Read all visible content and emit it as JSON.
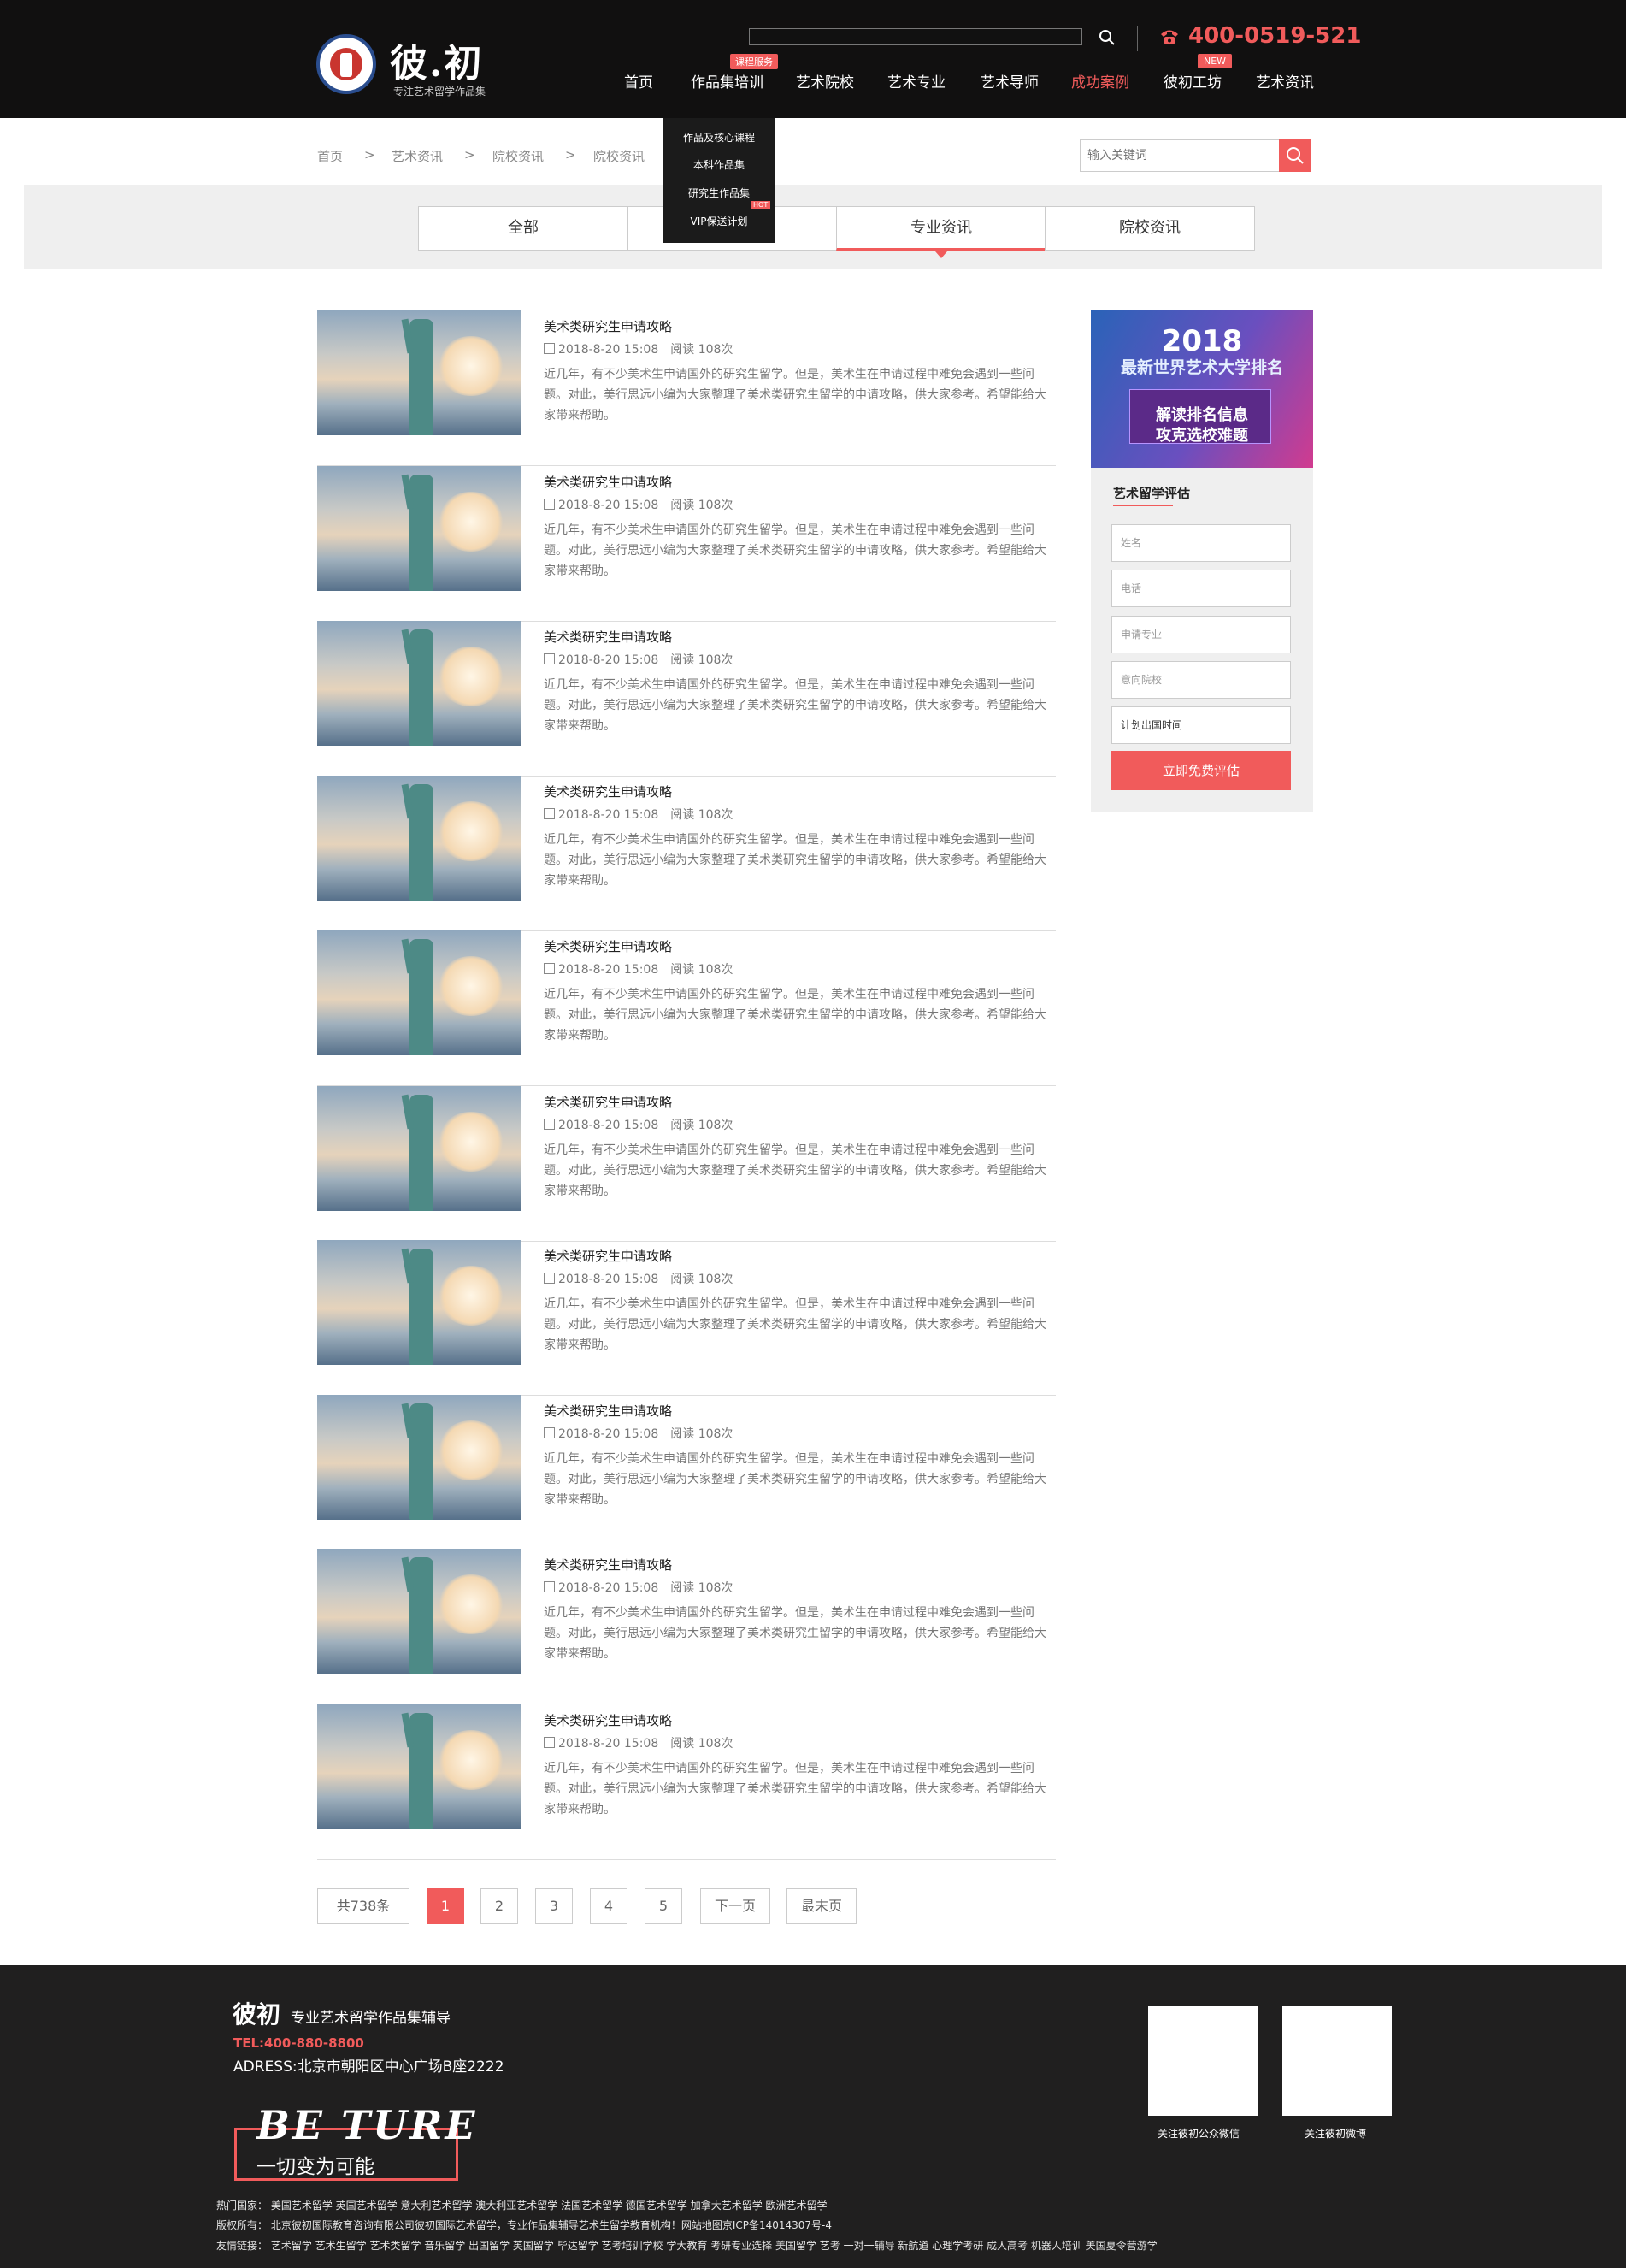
{
  "header": {
    "brand": "彼.初",
    "brand_sub": "专注艺术留学作品集",
    "search_placeholder": "",
    "phone": "400-0519-521",
    "nav": [
      {
        "label": "首页",
        "badge": ""
      },
      {
        "label": "作品集培训",
        "badge": "课程服务"
      },
      {
        "label": "艺术院校",
        "badge": ""
      },
      {
        "label": "艺术专业",
        "badge": ""
      },
      {
        "label": "艺术导师",
        "badge": ""
      },
      {
        "label": "成功案例",
        "badge": ""
      },
      {
        "label": "彼初工坊",
        "badge": "NEW"
      },
      {
        "label": "艺术资讯",
        "badge": ""
      }
    ],
    "dropdown": [
      "作品及核心课程",
      "本科作品集",
      "研究生作品集",
      "VIP保送计划"
    ],
    "dropdown_hot": "HOT"
  },
  "breadcrumb": [
    "首页",
    ">",
    "艺术资讯",
    ">",
    "院校资讯",
    ">",
    "院校资讯"
  ],
  "search": {
    "placeholder": "输入关键词"
  },
  "tabs": [
    "全部",
    "",
    "专业资讯",
    "院校资讯"
  ],
  "article": {
    "title": "美术类研究生申请攻略",
    "date": "2018-8-20  15:08",
    "reads": "阅读  108次",
    "excerpt": "近几年，有不少美术生申请国外的研究生留学。但是，美术生在申请过程中难免会遇到一些问题。对此，美行思远小编为大家整理了美术类研究生留学的申请攻略，供大家参考。希望能给大家带来帮助。"
  },
  "sidebar": {
    "banner_year": "2018",
    "banner_line1": "最新世界艺术大学排名",
    "banner_line2": "解读排名信息",
    "banner_line3": "攻克选校难题",
    "form_title": "艺术留学评估",
    "fields": [
      "姓名",
      "电话",
      "申请专业",
      "意向院校",
      "计划出国时间"
    ],
    "submit": "立即免费评估"
  },
  "pagination": {
    "total": "共738条",
    "pages": [
      "1",
      "2",
      "3",
      "4",
      "5"
    ],
    "next": "下一页",
    "last": "最末页"
  },
  "footer": {
    "brand": "彼初",
    "slogan": "专业艺术留学作品集辅导",
    "tel": "TEL:400-880-8800",
    "address": "ADRESS:北京市朝阳区中心广场B座2222",
    "be_ture": "BE TURE",
    "motto": "一切变为可能",
    "qr_wechat": "关注彼初公众微信",
    "qr_weibo": "关注彼初微博",
    "hot_countries": "热门国家： 美国艺术留学 英国艺术留学 意大利艺术留学 澳大利亚艺术留学 法国艺术留学 德国艺术留学 加拿大艺术留学 欧洲艺术留学",
    "copyright": "版权所有： 北京彼初国际教育咨询有限公司彼初国际艺术留学，专业作品集辅导艺术生留学教育机构！网站地图京ICP备14014307号-4",
    "links": "友情链接： 艺术留学 艺术生留学 艺术类留学 音乐留学 出国留学 英国留学 毕达留学 艺考培训学校 学大教育 考研专业选择 美国留学 艺考 一对一辅导 新航道 心理学考研 成人高考 机器人培训 美国夏令营游学"
  },
  "colors": {
    "accent": "#f15b5b",
    "header_bg": "#111010",
    "footer_bg": "#201f1f"
  }
}
